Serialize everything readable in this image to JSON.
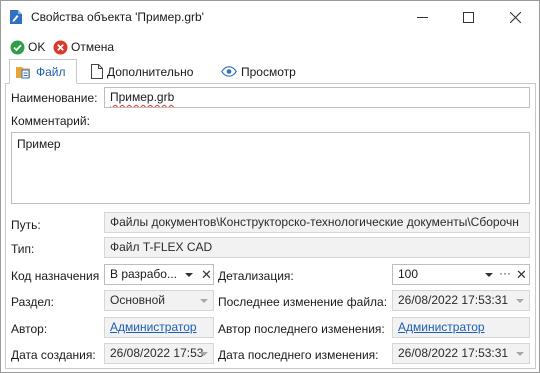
{
  "window": {
    "title": "Свойства объекта 'Пример.grb'",
    "icons": {
      "app": "document-icon",
      "minimize": "minimize-icon",
      "maximize": "maximize-icon",
      "close": "close-icon"
    }
  },
  "toolbar": {
    "ok_label": "OK",
    "cancel_label": "Отмена"
  },
  "tabs": [
    {
      "label": "Файл",
      "icon": "folder-file-icon",
      "active": true
    },
    {
      "label": "Дополнительно",
      "icon": "page-icon",
      "active": false
    },
    {
      "label": "Просмотр",
      "icon": "eye-icon",
      "active": false
    }
  ],
  "form": {
    "name_label": "Наименование:",
    "name_value": "Пример.grb",
    "comment_label": "Комментарий:",
    "comment_value": "Пример",
    "path_label": "Путь:",
    "path_value": "Файлы документов\\Конструкторско-технологические документы\\Сборочн",
    "type_label": "Тип:",
    "type_value": "Файл T-FLEX CAD",
    "purpose_label": "Код назначения",
    "purpose_value": "В разрабо...",
    "detail_label": "Детализация:",
    "detail_value": "100",
    "section_label": "Раздел:",
    "section_value": "Основной",
    "last_file_change_label": "Последнее изменение файла:",
    "last_file_change_value": "26/08/2022 17:53:31",
    "author_label": "Автор:",
    "author_value": "Администратор",
    "last_change_author_label": "Автор последнего изменения:",
    "last_change_author_value": "Администратор",
    "created_label": "Дата создания:",
    "created_value": "26/08/2022 17:53",
    "last_change_date_label": "Дата последнего изменения:",
    "last_change_date_value": "26/08/2022 17:53:31"
  },
  "colors": {
    "accent": "#1a5fb4",
    "ok": "#2e9e48",
    "cancel": "#d93a2b"
  }
}
